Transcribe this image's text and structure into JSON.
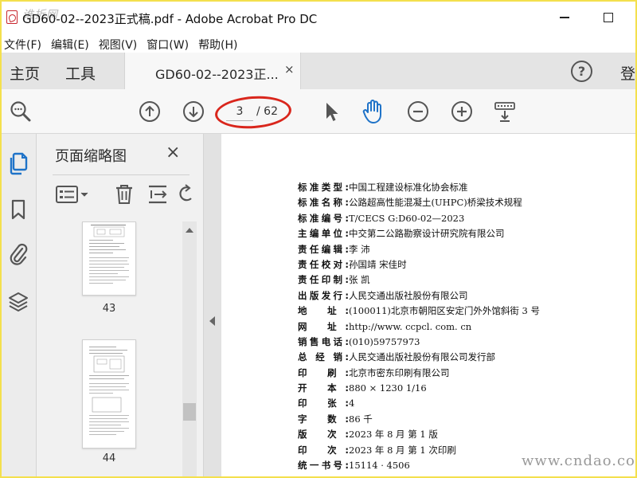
{
  "window": {
    "title": "GD60-02--2023正式稿.pdf - Adobe Acrobat Pro DC",
    "watermark_logo": "谁折网"
  },
  "menu": [
    {
      "label": "文件(F)"
    },
    {
      "label": "编辑(E)"
    },
    {
      "label": "视图(V)"
    },
    {
      "label": "窗口(W)"
    },
    {
      "label": "帮助(H)"
    }
  ],
  "tabs": {
    "home": "主页",
    "tools": "工具",
    "document": "GD60-02--2023正...",
    "close": "×",
    "help": "?",
    "login": "登"
  },
  "toolbar": {
    "current_page": "3",
    "total_pages": "/ 62",
    "icons": [
      "search-zoom-icon",
      "page-up-icon",
      "page-down-icon",
      "select-pointer-icon",
      "hand-tool-icon",
      "zoom-out-icon",
      "zoom-in-icon",
      "keyboard-scroll-icon"
    ],
    "accent_color": "#1f73c8",
    "annotation_color": "#d9261c"
  },
  "rail": {
    "icons": [
      "page-thumbnails-icon",
      "bookmarks-icon",
      "attachments-icon",
      "layers-icon"
    ]
  },
  "thumbnail_panel": {
    "title": "页面缩略图",
    "close": "×",
    "thumbnails": [
      {
        "page": "43"
      },
      {
        "page": "44"
      }
    ]
  },
  "document": {
    "imprint": [
      {
        "label": "标准类型:",
        "value": "中国工程建设标准化协会标准"
      },
      {
        "label": "标准名称:",
        "value": "公路超高性能混凝土(UHPC)桥梁技术规程"
      },
      {
        "label": "标准编号:",
        "value": "T/CECS G:D60-02—2023"
      },
      {
        "label": "主编单位:",
        "value": "中交第二公路勘察设计研究院有限公司"
      },
      {
        "label": "责任编辑:",
        "value": "李   沛"
      },
      {
        "label": "责任校对:",
        "value": "孙国靖   宋佳时"
      },
      {
        "label": "责任印制:",
        "value": "张   凯"
      },
      {
        "label": "出版发行:",
        "value": "人民交通出版社股份有限公司"
      },
      {
        "label": "地   址:",
        "value": "(100011)北京市朝阳区安定门外外馆斜街 3 号"
      },
      {
        "label": "网   址:",
        "value": "http://www. ccpcl. com. cn"
      },
      {
        "label": "销售电话:",
        "value": "(010)59757973"
      },
      {
        "label": "总 经 销:",
        "value": "人民交通出版社股份有限公司发行部"
      },
      {
        "label": "印   刷:",
        "value": "北京市密东印刷有限公司"
      },
      {
        "label": "开   本:",
        "value": "880 × 1230   1/16"
      },
      {
        "label": "印   张:",
        "value": "4"
      },
      {
        "label": "字   数:",
        "value": "86 千"
      },
      {
        "label": "版   次:",
        "value": "2023 年 8 月   第 1 版"
      },
      {
        "label": "印   次:",
        "value": "2023 年 8 月   第 1 次印刷"
      },
      {
        "label": "统一书号:",
        "value": "15114 · 4506"
      }
    ],
    "site_watermark": "www.cndao.com"
  }
}
